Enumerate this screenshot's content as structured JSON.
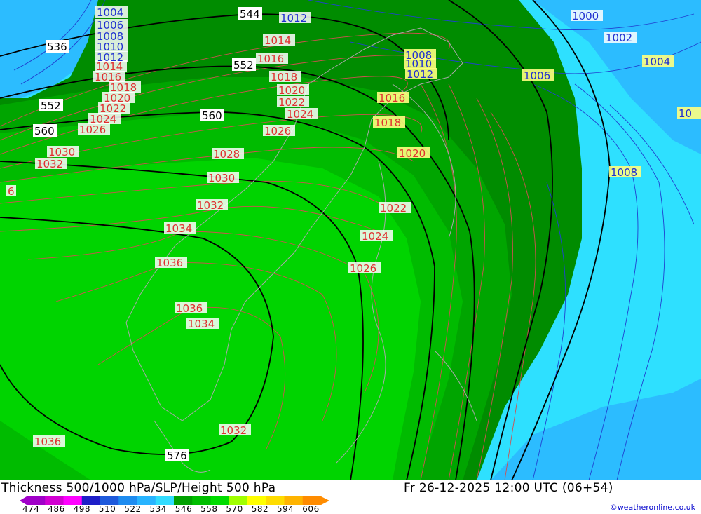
{
  "title": "Thickness 500/1000 hPa/SLP/Height 500 hPa",
  "valid_time": "Fr 26-12-2025 12:00 UTC (06+54)",
  "credit": "©weatheronline.co.uk",
  "legend": {
    "ticks": [
      "474",
      "486",
      "498",
      "510",
      "522",
      "534",
      "546",
      "558",
      "570",
      "582",
      "594",
      "606"
    ],
    "colors": [
      "#a000c8",
      "#d200d2",
      "#ff00ff",
      "#1e1ec8",
      "#1e5adc",
      "#1e8cf0",
      "#28b4ff",
      "#32dcff",
      "#00a000",
      "#00be00",
      "#00dc00",
      "#a0ff00",
      "#ffff00",
      "#ffdc00",
      "#ffb400",
      "#ff8c00"
    ]
  },
  "height_labels": [
    "544",
    "536",
    "552",
    "552",
    "560",
    "560",
    "576"
  ],
  "slp_labels_red": [
    "1014",
    "1016",
    "1018",
    "1020",
    "1022",
    "1024",
    "1026",
    "1030",
    "1032",
    "6",
    "1014",
    "1016",
    "1018",
    "1020",
    "1022",
    "1024",
    "1026",
    "1028",
    "1030",
    "1032",
    "1034",
    "1036",
    "1036",
    "1034",
    "1032",
    "1036",
    "1016",
    "1018",
    "1020",
    "1022",
    "1024",
    "1026"
  ],
  "slp_labels_blue": [
    "1004",
    "1006",
    "1008",
    "1010",
    "1012",
    "1012",
    "1000",
    "1002",
    "1004",
    "10",
    "1008",
    "1012",
    "1010",
    "1006",
    "1008"
  ],
  "colors": {
    "dark_green": "#008c00",
    "mid_green": "#00aa00",
    "green": "#00c800",
    "light_green": "#00dc00",
    "cyan": "#32dcff",
    "light_blue": "#28b4ff",
    "aqua": "#00e6ff"
  }
}
